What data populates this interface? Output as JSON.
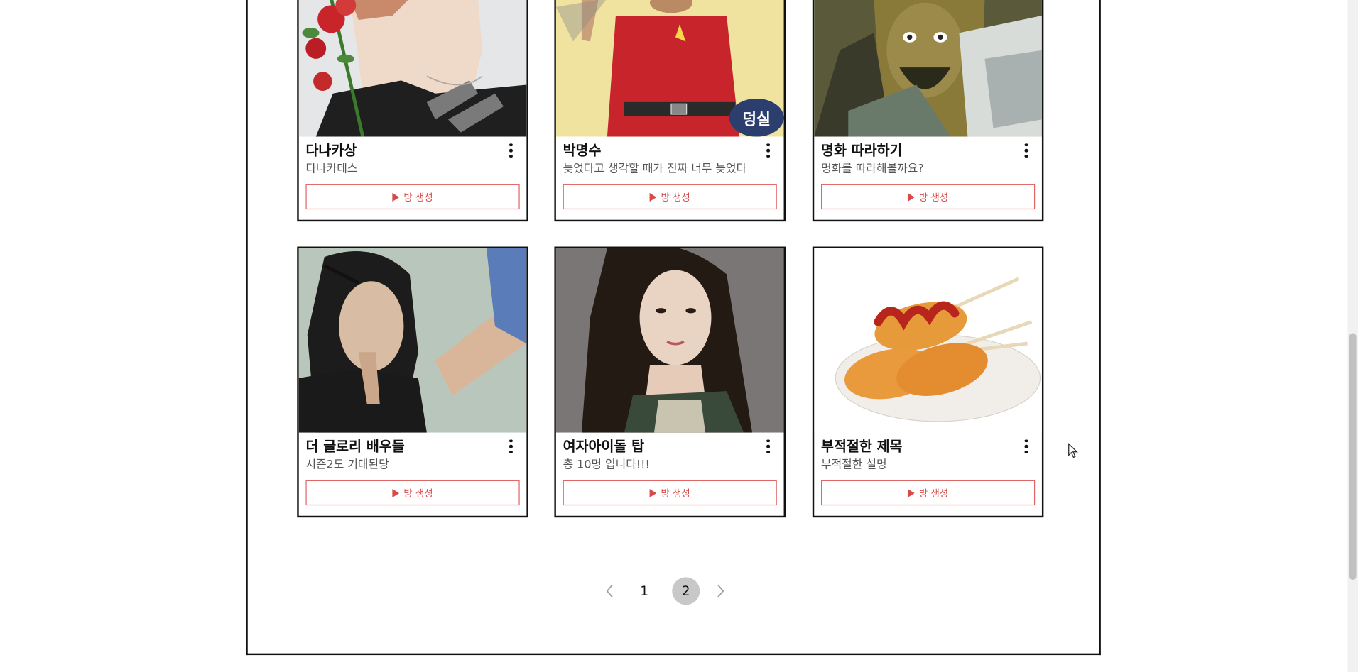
{
  "cards": [
    {
      "title": "다나카상",
      "description": "다나카데스",
      "button_label": "방 생성",
      "icon": "play-icon"
    },
    {
      "title": "박명수",
      "description": "늦었다고 생각할 때가 진짜 너무 늦었다",
      "button_label": "방 생성",
      "icon": "play-icon",
      "image_badge": "덩실"
    },
    {
      "title": "명화 따라하기",
      "description": "명화를 따라해볼까요?",
      "button_label": "방 생성",
      "icon": "play-icon"
    },
    {
      "title": "더 글로리 배우들",
      "description": "시즌2도 기대된당",
      "button_label": "방 생성",
      "icon": "play-icon"
    },
    {
      "title": "여자아이돌 탑",
      "description": "총 10명 입니다!!!",
      "button_label": "방 생성",
      "icon": "play-icon"
    },
    {
      "title": "부적절한 제목",
      "description": "부적절한 설명",
      "button_label": "방 생성",
      "icon": "play-icon"
    }
  ],
  "pagination": {
    "prev_icon": "chevron-left-icon",
    "next_icon": "chevron-right-icon",
    "pages": [
      "1",
      "2"
    ],
    "current_page": "2"
  },
  "colors": {
    "accent": "#d84a4a",
    "border": "#111111",
    "active_page_bg": "#c8c8c8"
  }
}
